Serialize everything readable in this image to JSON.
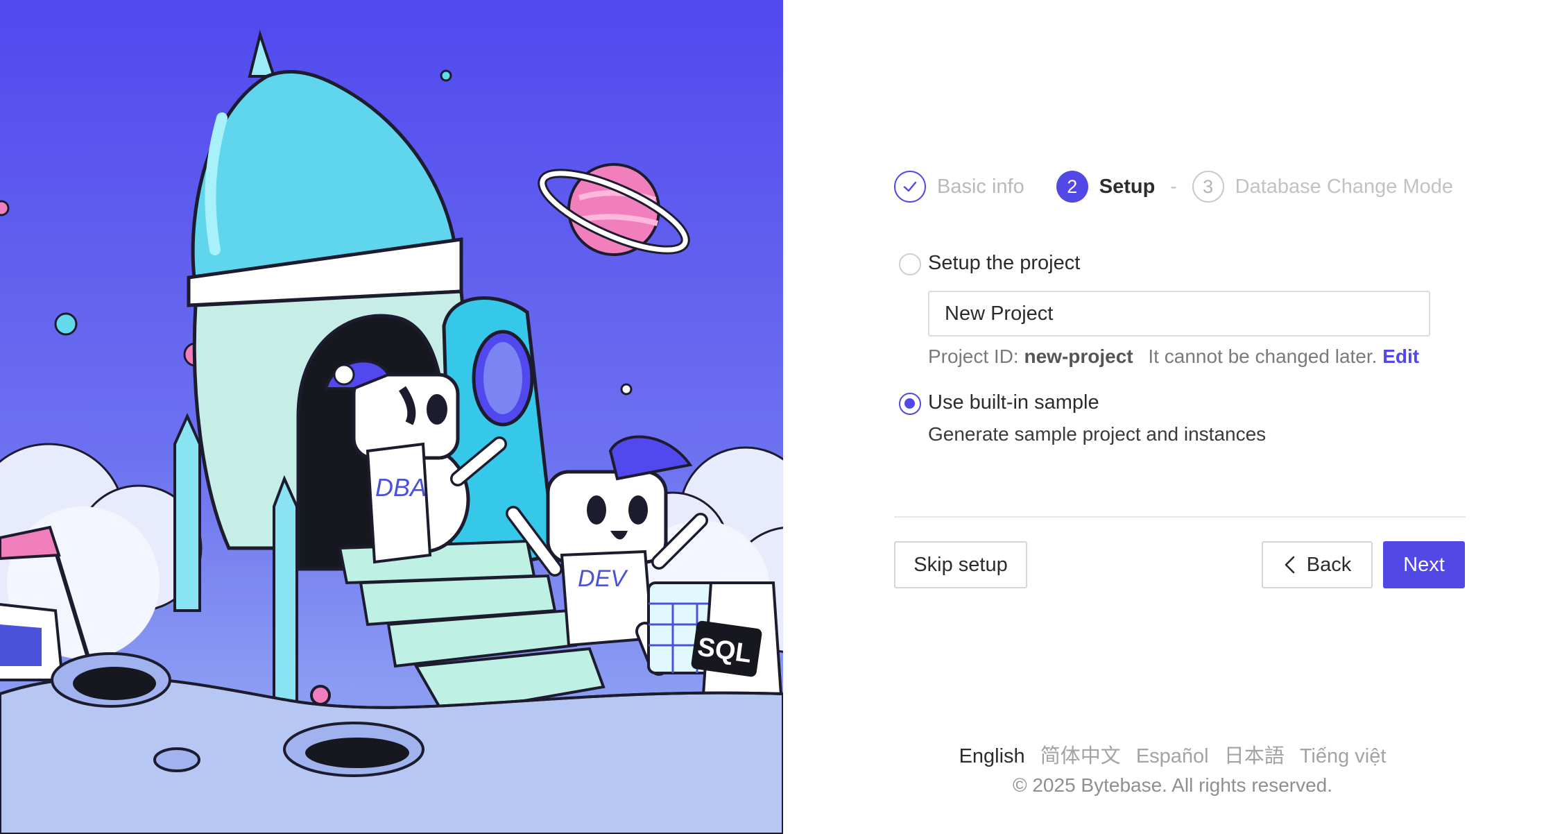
{
  "brand": {
    "accent": "#5148e5"
  },
  "steps": [
    {
      "label": "Basic info",
      "status": "completed",
      "icon": "check-icon"
    },
    {
      "number": "2",
      "label": "Setup",
      "status": "active"
    },
    {
      "number": "3",
      "label": "Database Change Mode",
      "status": "pending"
    }
  ],
  "step_separator": "-",
  "options": {
    "setup_project": {
      "label": "Setup the project",
      "selected": false,
      "input_value": "New Project",
      "project_id_prefix": "Project ID:",
      "project_id": "new-project",
      "project_id_note": "It cannot be changed later.",
      "edit_label": "Edit"
    },
    "sample": {
      "label": "Use built-in sample",
      "selected": true,
      "description": "Generate sample project and instances"
    }
  },
  "buttons": {
    "skip": "Skip setup",
    "back": "Back",
    "next": "Next"
  },
  "languages": [
    {
      "label": "English",
      "current": true
    },
    {
      "label": "简体中文",
      "current": false
    },
    {
      "label": "Español",
      "current": false
    },
    {
      "label": "日本語",
      "current": false
    },
    {
      "label": "Tiếng việt",
      "current": false
    }
  ],
  "footer": {
    "copyright": "© 2025 Bytebase. All rights reserved."
  },
  "hero": {
    "badge_dba": "DBA",
    "badge_dev": "DEV",
    "sign_sql": "SQL",
    "colors": {
      "sky_top": "#5148ee",
      "sky_bottom": "#9eb6f3",
      "rocket": "#5fd6ee",
      "planet": "#f27fbd"
    }
  }
}
